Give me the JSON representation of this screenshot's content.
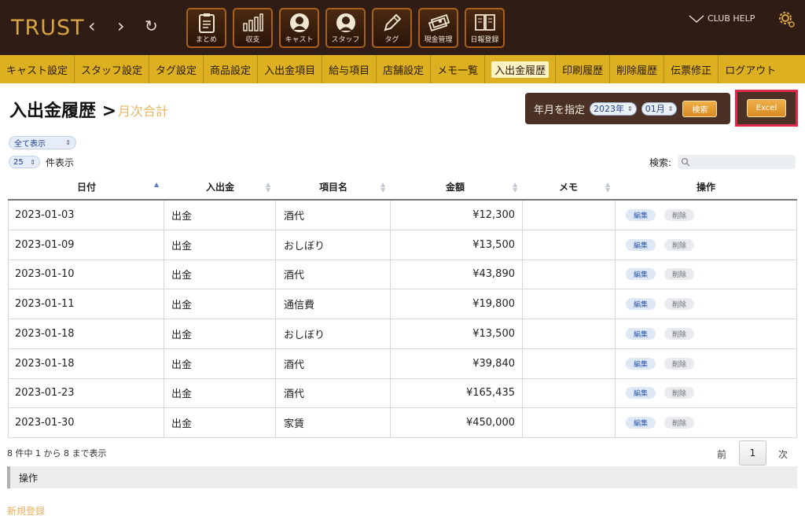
{
  "header": {
    "logo": "TRUST",
    "club_help": "CLUB HELP",
    "nav_icons": [
      {
        "label": "まとめ",
        "icon": "clipboard-icon"
      },
      {
        "label": "収支",
        "icon": "bar-chart-icon"
      },
      {
        "label": "キャスト",
        "icon": "cast-person-icon"
      },
      {
        "label": "スタッフ",
        "icon": "staff-person-icon"
      },
      {
        "label": "タグ",
        "icon": "pencil-tag-icon"
      },
      {
        "label": "現金管理",
        "icon": "cash-icon"
      },
      {
        "label": "日報登録",
        "icon": "book-icon"
      }
    ]
  },
  "menu": {
    "items": [
      "キャスト設定",
      "スタッフ設定",
      "タグ設定",
      "商品設定",
      "入出金項目",
      "給与項目",
      "店舗設定",
      "メモ一覧",
      "入出金履歴",
      "印刷履歴",
      "削除履歴",
      "伝票修正",
      "ログアウト"
    ],
    "active_index": 8
  },
  "page": {
    "title": "入出金履歴",
    "title_sep": ">",
    "subtitle": "月次合計"
  },
  "filter": {
    "label": "年月を指定",
    "year": "2023年",
    "month": "01月",
    "search_button": "検索",
    "excel_button": "Excel"
  },
  "controls": {
    "show_filter": "全て表示",
    "page_size": "25",
    "page_size_label": "件表示",
    "search_label": "検索:",
    "search_value": ""
  },
  "table": {
    "columns": [
      "日付",
      "入出金",
      "項目名",
      "金額",
      "メモ",
      "操作"
    ],
    "edit_label": "編集",
    "delete_label": "削除",
    "rows": [
      {
        "date": "2023-01-03",
        "io": "出金",
        "item": "酒代",
        "amount": "¥12,300",
        "memo": ""
      },
      {
        "date": "2023-01-09",
        "io": "出金",
        "item": "おしぼり",
        "amount": "¥13,500",
        "memo": ""
      },
      {
        "date": "2023-01-10",
        "io": "出金",
        "item": "酒代",
        "amount": "¥43,890",
        "memo": ""
      },
      {
        "date": "2023-01-11",
        "io": "出金",
        "item": "通信費",
        "amount": "¥19,800",
        "memo": ""
      },
      {
        "date": "2023-01-18",
        "io": "出金",
        "item": "おしぼり",
        "amount": "¥13,500",
        "memo": ""
      },
      {
        "date": "2023-01-18",
        "io": "出金",
        "item": "酒代",
        "amount": "¥39,840",
        "memo": ""
      },
      {
        "date": "2023-01-23",
        "io": "出金",
        "item": "酒代",
        "amount": "¥165,435",
        "memo": ""
      },
      {
        "date": "2023-01-30",
        "io": "出金",
        "item": "家賃",
        "amount": "¥450,000",
        "memo": ""
      }
    ]
  },
  "footer": {
    "info": "8 件中 1 から 8 まで表示",
    "prev": "前",
    "current_page": "1",
    "next": "次",
    "ops_header": "操作",
    "new_register": "新規登録"
  },
  "colors": {
    "header_bg": "#2f1c14",
    "menu_bg": "#dcb020",
    "accent_orange": "#e6b866",
    "highlight_red": "#e0284a"
  }
}
